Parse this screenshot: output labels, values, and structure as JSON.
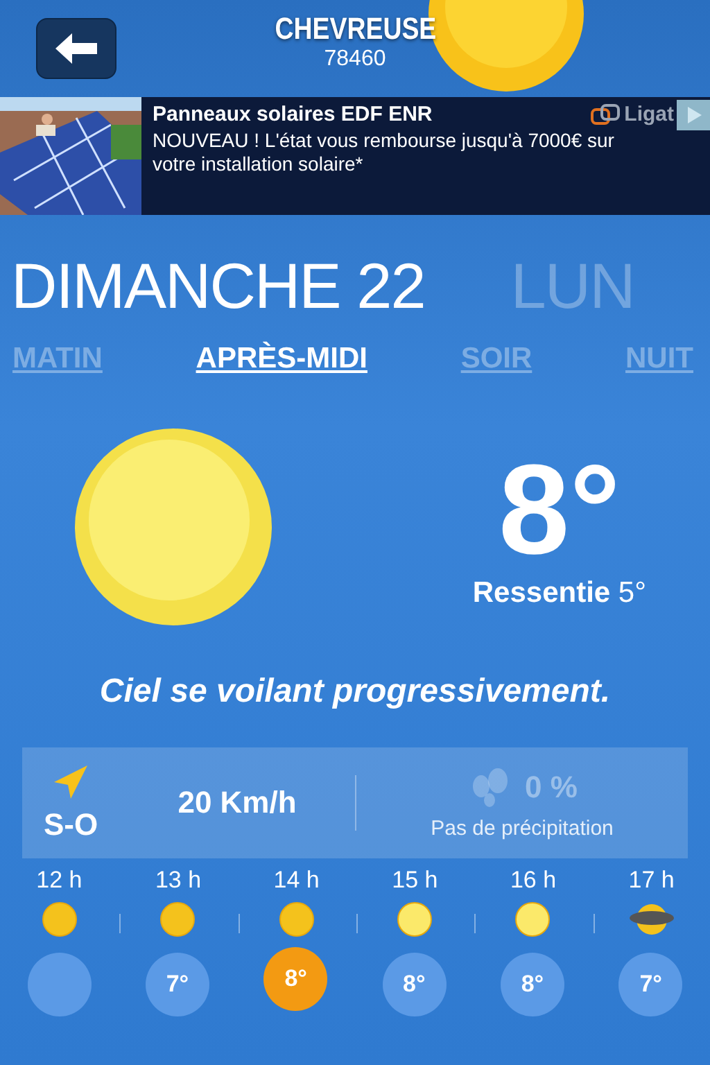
{
  "header": {
    "city": "CHEVREUSE",
    "postcode": "78460"
  },
  "ad": {
    "title": "Panneaux solaires EDF ENR",
    "text": "NOUVEAU ! L'état vous rembourse jusqu'à 7000€ sur votre installation solaire*",
    "brand": "Ligat"
  },
  "days": [
    {
      "label": "DIMANCHE 22",
      "selected": true
    },
    {
      "label": "LUN",
      "selected": false
    }
  ],
  "periods": [
    {
      "label": "MATIN",
      "selected": false
    },
    {
      "label": "APRÈS-MIDI",
      "selected": true
    },
    {
      "label": "SOIR",
      "selected": false
    },
    {
      "label": "NUIT",
      "selected": false
    }
  ],
  "current": {
    "temperature": "8°",
    "feels_label": "Ressentie",
    "feels_value": "5°",
    "description": "Ciel se voilant progressivement."
  },
  "wind": {
    "direction": "S-O",
    "speed": "20 Km/h"
  },
  "rain": {
    "percent": "0 %",
    "label": "Pas de précipitation"
  },
  "hours": [
    {
      "time": "12 h",
      "kind": "sun"
    },
    {
      "time": "13 h",
      "kind": "sun"
    },
    {
      "time": "14 h",
      "kind": "sun"
    },
    {
      "time": "15 h",
      "kind": "pale-sun"
    },
    {
      "time": "16 h",
      "kind": "pale-sun"
    },
    {
      "time": "17 h",
      "kind": "cloud-sun"
    }
  ],
  "temps": [
    {
      "selected": false
    },
    {
      "value": "7°",
      "selected": false
    },
    {
      "value": "8°",
      "selected": true
    },
    {
      "value": "8°",
      "selected": false
    },
    {
      "value": "8°",
      "selected": false
    },
    {
      "value": "7°",
      "selected": false
    }
  ]
}
